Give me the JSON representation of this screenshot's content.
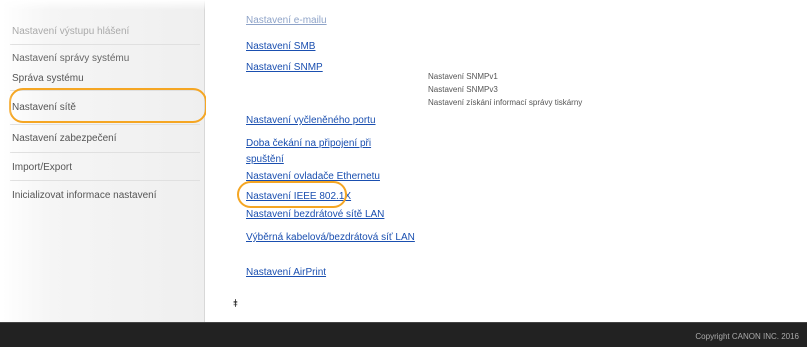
{
  "sidebar": {
    "items": [
      {
        "label": "Nastavení výstupu hlášení",
        "faded": true
      },
      {
        "label": "Nastavení správy systému",
        "section": true
      },
      {
        "label": "Správa systému"
      },
      {
        "label": "Nastavení sítě",
        "highlighted": true
      },
      {
        "label": "Nastavení zabezpečení"
      },
      {
        "label": "Import/Export"
      },
      {
        "label": "Inicializovat informace nastavení"
      }
    ]
  },
  "main": {
    "links": [
      {
        "label": "Nastavení e-mailu",
        "faded": true
      },
      {
        "label": "Nastavení SMB"
      },
      {
        "label": "Nastavení SNMP"
      },
      {
        "label": "Nastavení vyčleněného portu"
      },
      {
        "label": "Doba čekání na připojení při spuštění"
      },
      {
        "label": "Nastavení ovladače Ethernetu"
      },
      {
        "label": "Nastavení IEEE 802.1X",
        "highlighted": true
      },
      {
        "label": "Nastavení bezdrátové sítě LAN"
      },
      {
        "label": "Výběrná kabelová/bezdrátová síť LAN"
      },
      {
        "label": "Nastavení AirPrint"
      }
    ],
    "snmp_subitems": [
      "Nastavení SNMPv1",
      "Nastavení SNMPv3",
      "Nastavení získání informací správy tiskárny"
    ],
    "top_icon": "⯒"
  },
  "footer": {
    "copyright": "Copyright CANON INC. 2016"
  },
  "colors": {
    "highlight": "#f5a623",
    "link": "#1a4fb0",
    "footer": "#222222"
  }
}
